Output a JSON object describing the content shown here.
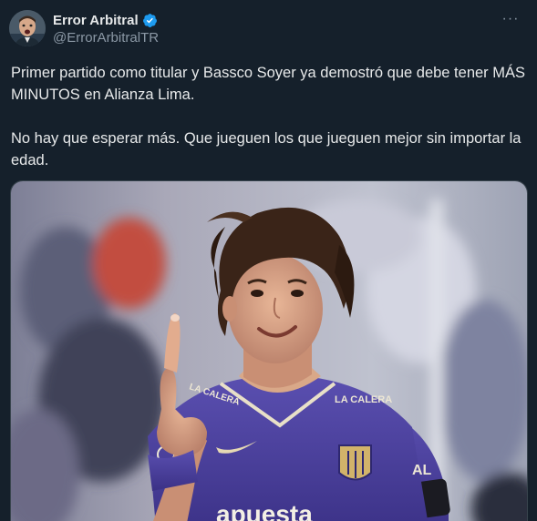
{
  "author": {
    "display_name": "Error Arbitral",
    "handle": "@ErrorArbitralTR",
    "verified": true,
    "avatar_icon": "avatar-icon"
  },
  "menu": {
    "icon": "more-icon",
    "glyph": "···"
  },
  "tweet": {
    "paragraph_1": "Primer partido como titular y Bassco Soyer ya demostró que debe tener MÁS MINUTOS en Alianza Lima.",
    "paragraph_2": "No hay que esperar más. Que jueguen los que jueguen mejor sin importar la edad."
  },
  "media": {
    "jersey_text_left": "LA CALERA",
    "jersey_text_right": "LA CALERA",
    "sponsor_text": "apuesta",
    "collar_text": "AL"
  },
  "colors": {
    "background": "#15202b",
    "text_primary": "#e7e9ea",
    "text_secondary": "#8b98a5",
    "verified": "#1d9bf0",
    "jersey": "#4b3e9c"
  }
}
